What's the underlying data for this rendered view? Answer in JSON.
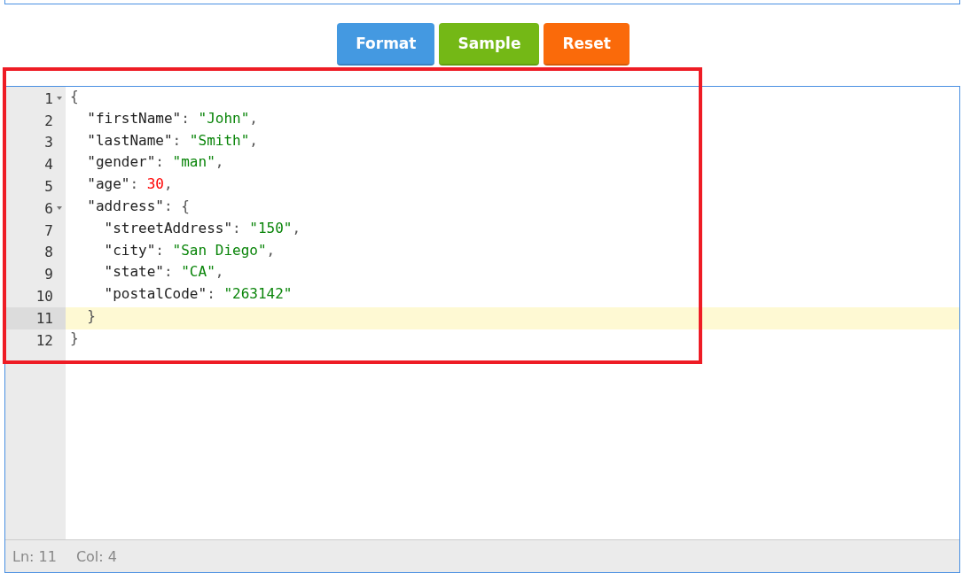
{
  "buttons": [
    {
      "label": "Format",
      "kind": "format"
    },
    {
      "label": "Sample",
      "kind": "sample"
    },
    {
      "label": "Reset",
      "kind": "reset"
    }
  ],
  "editor": {
    "lines": [
      {
        "number": "1",
        "foldable": true,
        "active": false,
        "tokens": [
          {
            "kind": "punct",
            "text": "{"
          }
        ]
      },
      {
        "number": "2",
        "foldable": false,
        "active": false,
        "tokens": [
          {
            "kind": "key",
            "text": "  \"firstName\""
          },
          {
            "kind": "punct",
            "text": ": "
          },
          {
            "kind": "string",
            "text": "\"John\""
          },
          {
            "kind": "punct",
            "text": ","
          }
        ]
      },
      {
        "number": "3",
        "foldable": false,
        "active": false,
        "tokens": [
          {
            "kind": "key",
            "text": "  \"lastName\""
          },
          {
            "kind": "punct",
            "text": ": "
          },
          {
            "kind": "string",
            "text": "\"Smith\""
          },
          {
            "kind": "punct",
            "text": ","
          }
        ]
      },
      {
        "number": "4",
        "foldable": false,
        "active": false,
        "tokens": [
          {
            "kind": "key",
            "text": "  \"gender\""
          },
          {
            "kind": "punct",
            "text": ": "
          },
          {
            "kind": "string",
            "text": "\"man\""
          },
          {
            "kind": "punct",
            "text": ","
          }
        ]
      },
      {
        "number": "5",
        "foldable": false,
        "active": false,
        "tokens": [
          {
            "kind": "key",
            "text": "  \"age\""
          },
          {
            "kind": "punct",
            "text": ": "
          },
          {
            "kind": "number",
            "text": "30"
          },
          {
            "kind": "punct",
            "text": ","
          }
        ]
      },
      {
        "number": "6",
        "foldable": true,
        "active": false,
        "tokens": [
          {
            "kind": "key",
            "text": "  \"address\""
          },
          {
            "kind": "punct",
            "text": ": "
          },
          {
            "kind": "bracket",
            "text": "{"
          }
        ]
      },
      {
        "number": "7",
        "foldable": false,
        "active": false,
        "tokens": [
          {
            "kind": "key",
            "text": "    \"streetAddress\""
          },
          {
            "kind": "punct",
            "text": ": "
          },
          {
            "kind": "string",
            "text": "\"150\""
          },
          {
            "kind": "punct",
            "text": ","
          }
        ]
      },
      {
        "number": "8",
        "foldable": false,
        "active": false,
        "tokens": [
          {
            "kind": "key",
            "text": "    \"city\""
          },
          {
            "kind": "punct",
            "text": ": "
          },
          {
            "kind": "string",
            "text": "\"San Diego\""
          },
          {
            "kind": "punct",
            "text": ","
          }
        ]
      },
      {
        "number": "9",
        "foldable": false,
        "active": false,
        "tokens": [
          {
            "kind": "key",
            "text": "    \"state\""
          },
          {
            "kind": "punct",
            "text": ": "
          },
          {
            "kind": "string",
            "text": "\"CA\""
          },
          {
            "kind": "punct",
            "text": ","
          }
        ]
      },
      {
        "number": "10",
        "foldable": false,
        "active": false,
        "tokens": [
          {
            "kind": "key",
            "text": "    \"postalCode\""
          },
          {
            "kind": "punct",
            "text": ": "
          },
          {
            "kind": "string",
            "text": "\"263142\""
          }
        ]
      },
      {
        "number": "11",
        "foldable": false,
        "active": true,
        "tokens": [
          {
            "kind": "bracket",
            "text": "  }"
          }
        ]
      },
      {
        "number": "12",
        "foldable": false,
        "active": false,
        "tokens": [
          {
            "kind": "punct",
            "text": "}"
          }
        ]
      }
    ]
  },
  "status_bar": {
    "line": "Ln: 11",
    "column": "Col: 4"
  }
}
